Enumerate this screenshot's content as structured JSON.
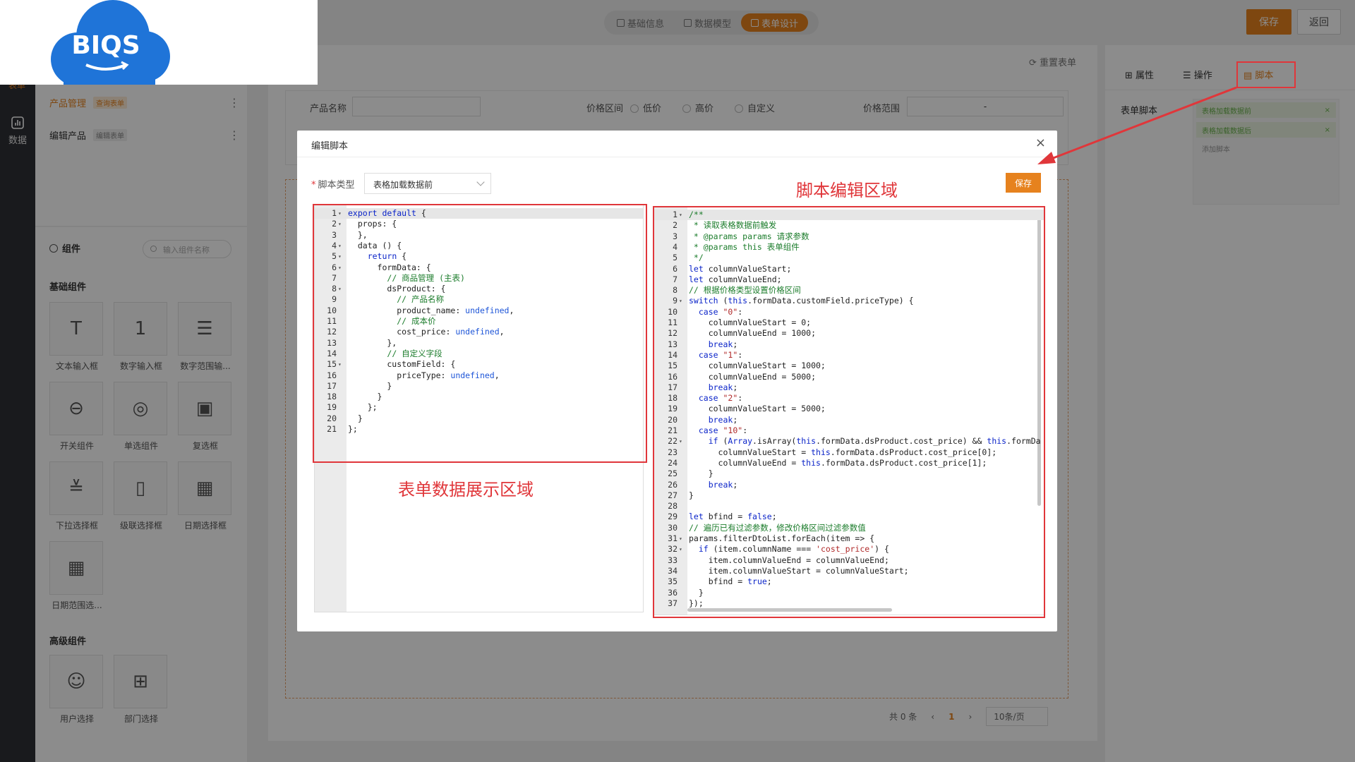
{
  "logo": {
    "text": "BIQS"
  },
  "nav": {
    "data_label": "数据",
    "form_label": "表单"
  },
  "steps": [
    {
      "label": "基础信息",
      "active": false
    },
    {
      "label": "数据模型",
      "active": false
    },
    {
      "label": "表单设计",
      "active": true
    }
  ],
  "topbar": {
    "save_label": "保存",
    "back_label": "返回"
  },
  "form_list": [
    {
      "name": "产品管理",
      "tag": "查询表单"
    },
    {
      "name": "编辑产品",
      "tag": "编辑表单"
    }
  ],
  "components": {
    "title": "组件",
    "search_placeholder": "输入组件名称",
    "basic_title": "基础组件",
    "basic": [
      {
        "label": "文本输入框",
        "icon": "text-input-icon"
      },
      {
        "label": "数字输入框",
        "icon": "number-input-icon"
      },
      {
        "label": "数字范围输...",
        "icon": "number-range-icon"
      },
      {
        "label": "开关组件",
        "icon": "switch-icon"
      },
      {
        "label": "单选组件",
        "icon": "radio-icon"
      },
      {
        "label": "复选框",
        "icon": "checkbox-icon"
      },
      {
        "label": "下拉选择框",
        "icon": "dropdown-icon"
      },
      {
        "label": "级联选择框",
        "icon": "cascader-icon"
      },
      {
        "label": "日期选择框",
        "icon": "date-picker-icon"
      },
      {
        "label": "日期范围选...",
        "icon": "date-range-icon"
      }
    ],
    "advanced_title": "高级组件",
    "advanced": [
      {
        "label": "用户选择",
        "icon": "user-select-icon"
      },
      {
        "label": "部门选择",
        "icon": "department-select-icon"
      }
    ]
  },
  "canvas": {
    "reset_label": "重置表单",
    "filter": {
      "product_name_label": "产品名称",
      "price_range_type_label": "价格区间",
      "radio_options": [
        "低价",
        "高价",
        "自定义"
      ],
      "price_range_label": "价格范围",
      "range_separator": "-"
    },
    "pager": {
      "total": "共 0 条",
      "current": "1",
      "page_size": "10条/页"
    }
  },
  "right_panel": {
    "tabs": [
      {
        "label": "属性",
        "active": false
      },
      {
        "label": "操作",
        "active": false
      },
      {
        "label": "脚本",
        "active": true
      }
    ],
    "script_label": "表单脚本",
    "scripts": [
      "表格加载数据前",
      "表格加载数据后"
    ],
    "add_label": "添加脚本"
  },
  "modal": {
    "title": "编辑脚本",
    "close_glyph": "×",
    "script_type_label": "脚本类型",
    "script_type_value": "表格加载数据前",
    "save_label": "保存",
    "left_code": [
      "export default {",
      "  props: {",
      "  },",
      "  data () {",
      "    return {",
      "      formData: {",
      "        // 商品管理 (主表)",
      "        dsProduct: {",
      "          // 产品名称",
      "          product_name: undefined,",
      "          // 成本价",
      "          cost_price: undefined,",
      "        },",
      "        // 自定义字段",
      "        customField: {",
      "          priceType: undefined,",
      "        }",
      "      }",
      "    };",
      "  }",
      "};"
    ],
    "right_code": [
      "/**",
      " * 读取表格数据前触发",
      " * @params params 请求参数",
      " * @params this 表单组件",
      " */",
      "let columnValueStart;",
      "let columnValueEnd;",
      "// 根据价格类型设置价格区间",
      "switch (this.formData.customField.priceType) {",
      "  case \"0\":",
      "    columnValueStart = 0;",
      "    columnValueEnd = 1000;",
      "    break;",
      "  case \"1\":",
      "    columnValueStart = 1000;",
      "    columnValueEnd = 5000;",
      "    break;",
      "  case \"2\":",
      "    columnValueStart = 5000;",
      "    break;",
      "  case \"10\":",
      "    if (Array.isArray(this.formData.dsProduct.cost_price) && this.formDa",
      "      columnValueStart = this.formData.dsProduct.cost_price[0];",
      "      columnValueEnd = this.formData.dsProduct.cost_price[1];",
      "    }",
      "    break;",
      "}",
      "",
      "let bfind = false;",
      "// 遍历已有过滤参数，修改价格区间过滤参数值",
      "params.filterDtoList.forEach(item => {",
      "  if (item.columnName === 'cost_price') {",
      "    item.columnValueEnd = columnValueEnd;",
      "    item.columnValueStart = columnValueStart;",
      "    bfind = true;",
      "  }",
      "});"
    ],
    "left_folds": [
      1,
      2,
      4,
      5,
      6,
      8,
      15
    ],
    "right_folds": [
      1,
      9,
      22,
      31,
      32
    ]
  },
  "annotations": {
    "left_label": "表单数据展示区域",
    "right_label": "脚本编辑区域",
    "color": "#e0363a"
  },
  "colors": {
    "accent": "#e6821e",
    "nav_bg": "#2f3035",
    "logo_blue": "#1f74d8"
  }
}
